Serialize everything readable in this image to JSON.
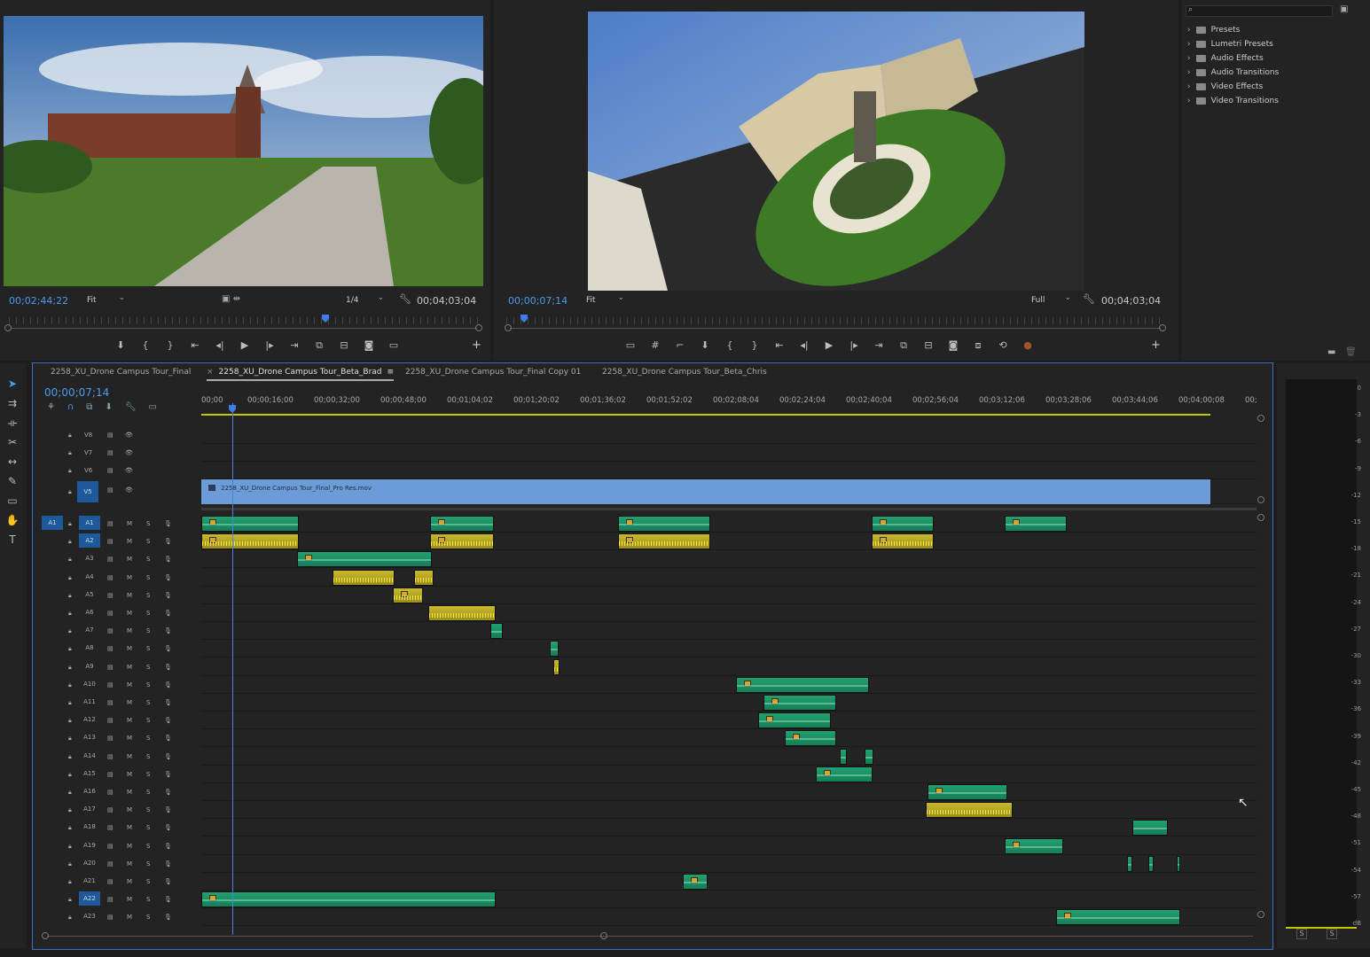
{
  "source_monitor": {
    "timecode": "00;02;44;22",
    "fit": "Fit",
    "resolution": "1/4",
    "duration": "00;04;03;04"
  },
  "program_monitor": {
    "timecode": "00;00;07;14",
    "fit": "Fit",
    "resolution": "Full",
    "duration": "00;04;03;04"
  },
  "effects_panel": {
    "items": [
      "Presets",
      "Lumetri Presets",
      "Audio Effects",
      "Audio Transitions",
      "Video Effects",
      "Video Transitions"
    ]
  },
  "timeline": {
    "tabs": [
      "2258_XU_Drone Campus Tour_Final",
      "2258_XU_Drone Campus Tour_Beta_Brad",
      "2258_XU_Drone Campus Tour_Final Copy 01",
      "2258_XU_Drone Campus Tour_Beta_Chris"
    ],
    "active_tab": 1,
    "timecode": "00;00;07;14",
    "ruler": [
      "00;00",
      "00;00;16;00",
      "00;00;32;00",
      "00;00;48;00",
      "00;01;04;02",
      "00;01;20;02",
      "00;01;36;02",
      "00;01;52;02",
      "00;02;08;04",
      "00;02;24;04",
      "00;02;40;04",
      "00;02;56;04",
      "00;03;12;06",
      "00;03;28;06",
      "00;03;44;06",
      "00;04;00;08",
      "00;"
    ],
    "video_tracks": [
      "V8",
      "V7",
      "V6",
      "V5"
    ],
    "video_clip": "2258_XU_Drone Campus Tour_Final_Pro Res.mov",
    "audio_tracks": [
      "A1",
      "A2",
      "A3",
      "A4",
      "A5",
      "A6",
      "A7",
      "A8",
      "A9",
      "A10",
      "A11",
      "A12",
      "A13",
      "A14",
      "A15",
      "A16",
      "A17",
      "A18",
      "A19",
      "A20",
      "A21",
      "A22",
      "A23"
    ],
    "source_patch": "A1",
    "mute_label": "M",
    "solo_label": "S"
  },
  "meter": {
    "scale": [
      "0",
      "-3",
      "-6",
      "-9",
      "-12",
      "-15",
      "-18",
      "-21",
      "-24",
      "-27",
      "-30",
      "-33",
      "-36",
      "-39",
      "-42",
      "-45",
      "-48",
      "-51",
      "-54",
      "-57",
      "dB"
    ],
    "solo_buttons": [
      "S",
      "S"
    ]
  }
}
